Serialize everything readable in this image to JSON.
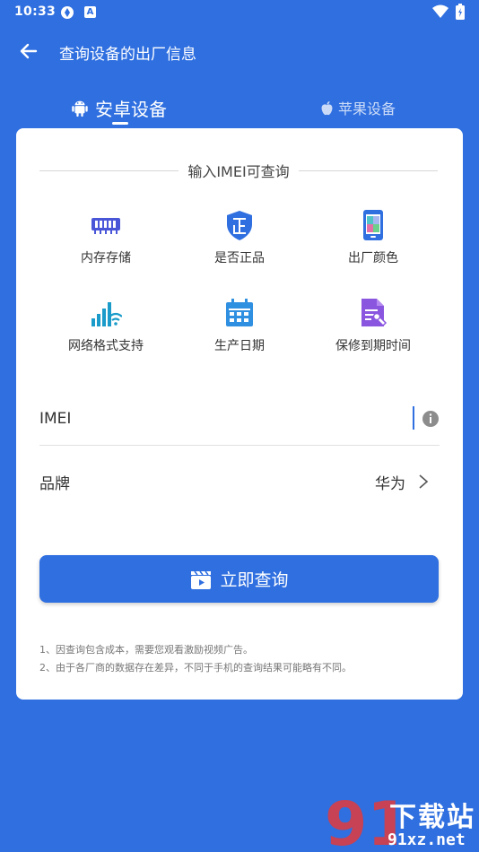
{
  "status_bar": {
    "time": "10:33",
    "icon_a_letter": "A"
  },
  "app_bar": {
    "title": "查询设备的出厂信息",
    "back_icon": "arrow-left-icon"
  },
  "tabs": [
    {
      "label": "安卓设备",
      "icon": "android-icon",
      "active": true
    },
    {
      "label": "苹果设备",
      "icon": "apple-icon",
      "active": false
    }
  ],
  "card": {
    "section_title": "输入IMEI可查询",
    "features": [
      {
        "label": "内存存储",
        "icon": "memory-icon"
      },
      {
        "label": "是否正品",
        "icon": "authentic-shield-icon"
      },
      {
        "label": "出厂颜色",
        "icon": "phone-color-icon"
      },
      {
        "label": "网络格式支持",
        "icon": "network-signal-icon"
      },
      {
        "label": "生产日期",
        "icon": "calendar-icon"
      },
      {
        "label": "保修到期时间",
        "icon": "warranty-document-icon"
      }
    ],
    "imei": {
      "label": "IMEI",
      "value": "",
      "placeholder": ""
    },
    "brand": {
      "label": "品牌",
      "value": "华为",
      "chevron": ">"
    },
    "query_button": {
      "label": "立即查询",
      "icon": "clapper-icon"
    },
    "notes": [
      "1、因查询包含成本，需要您观看激励视频广告。",
      "2、由于各厂商的数据存在差异，不同于手机的查询结果可能略有不同。"
    ]
  },
  "watermark": {
    "title": "下载站",
    "site": "91xz.net",
    "logo_text": "91"
  },
  "colors": {
    "primary": "#2f6fe0",
    "card": "#ffffff",
    "watermark_red": "#e23b3b"
  }
}
